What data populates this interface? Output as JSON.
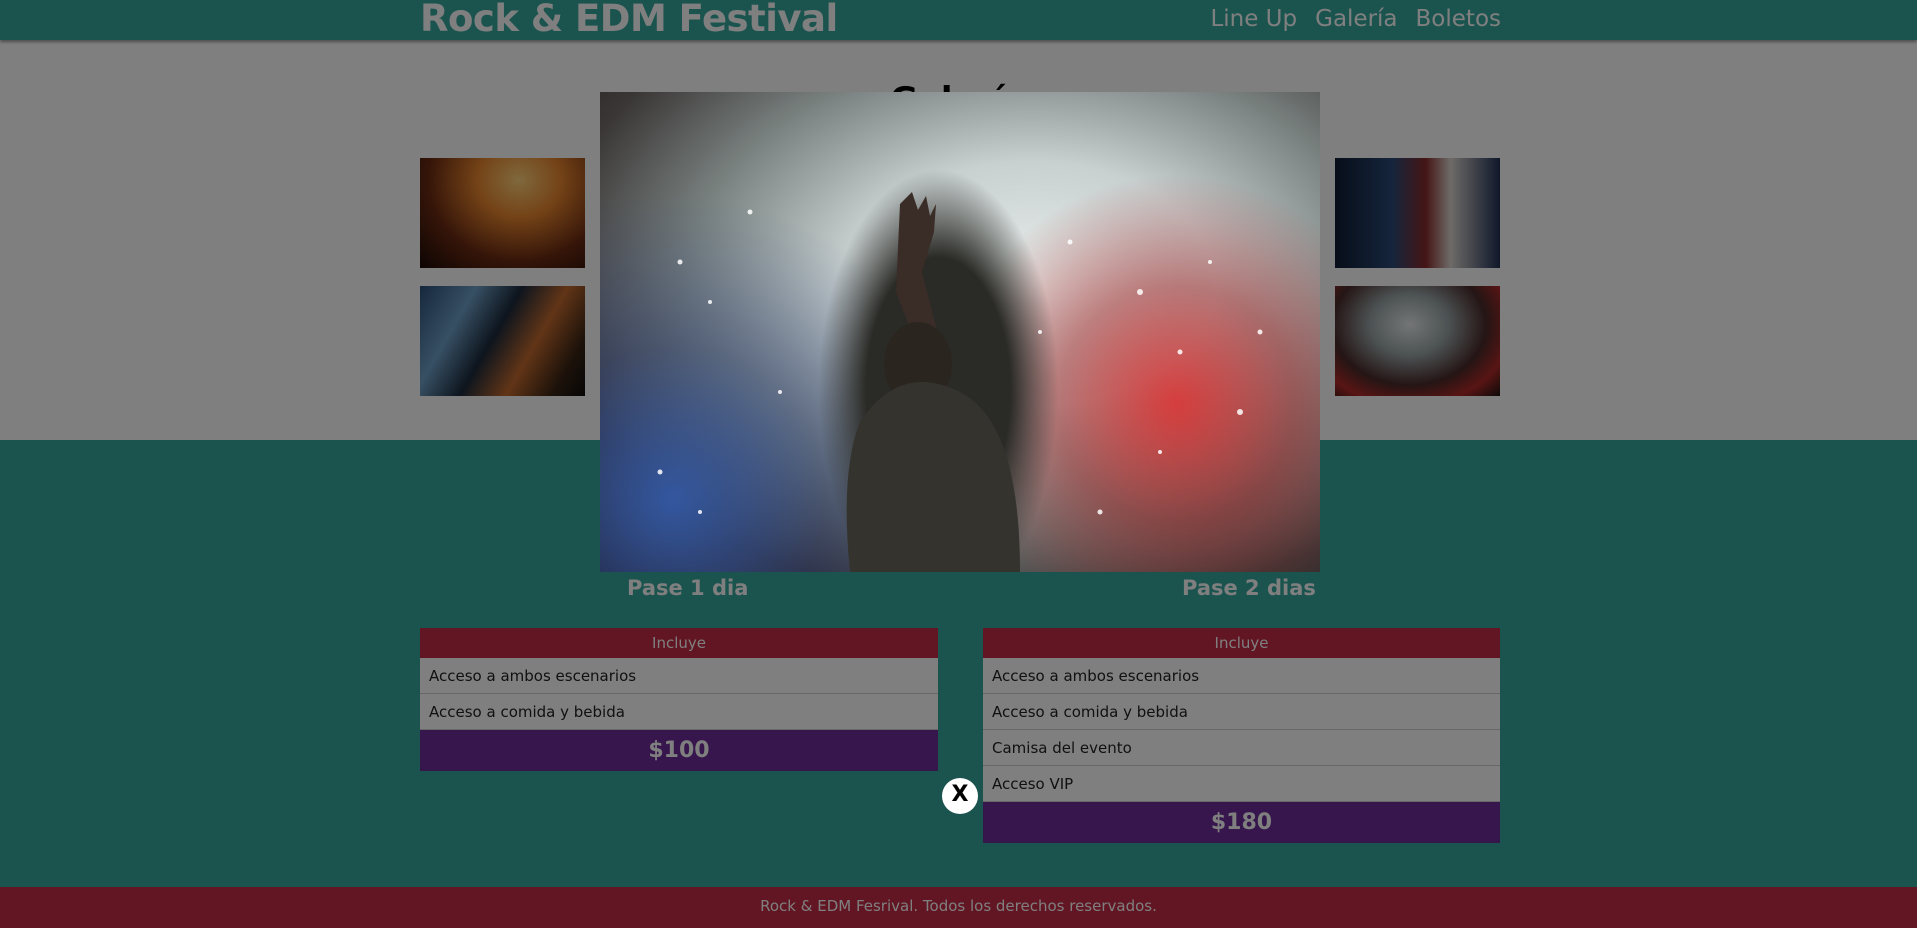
{
  "header": {
    "logo": "Rock & EDM Festival",
    "nav": [
      "Line Up",
      "Galería",
      "Boletos"
    ]
  },
  "gallery": {
    "title": "Galería"
  },
  "tickets": {
    "passes": [
      {
        "title": "Pase 1 dia",
        "header": "Incluye",
        "items": [
          "Acceso a ambos escenarios",
          "Acceso a comida y bebida"
        ],
        "price": "$100"
      },
      {
        "title": "Pase 2 dias",
        "header": "Incluye",
        "items": [
          "Acceso a ambos escenarios",
          "Acceso a comida y bebida",
          "Camisa del evento",
          "Acceso VIP"
        ],
        "price": "$180"
      }
    ]
  },
  "footer": {
    "text": "Rock & EDM Fesrival. Todos los derechos reservados."
  },
  "modal": {
    "close_label": "X"
  },
  "colors": {
    "header": "#37a99f",
    "accent_red": "#c52a44",
    "price_purple": "#6f2a9a"
  }
}
